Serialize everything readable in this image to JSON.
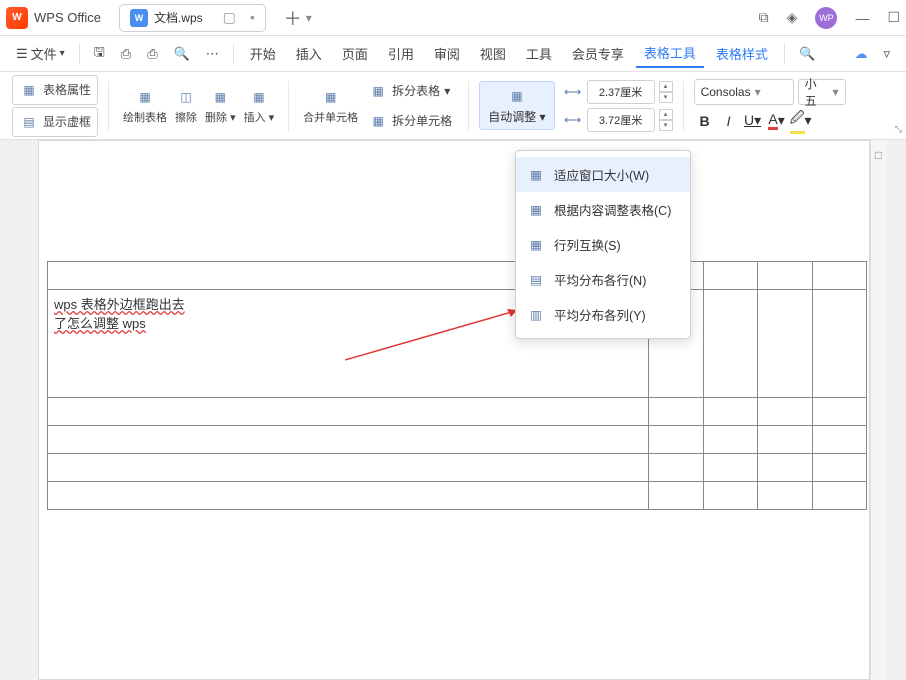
{
  "title_bar": {
    "app_name": "WPS Office",
    "tab_name": "文档.wps",
    "avatar": "WP"
  },
  "file_menu": {
    "label": "文件"
  },
  "menu": {
    "start": "开始",
    "insert": "插入",
    "page": "页面",
    "ref": "引用",
    "review": "审阅",
    "view": "视图",
    "tools": "工具",
    "member": "会员专享",
    "table_tools": "表格工具",
    "table_style": "表格样式"
  },
  "ribbon": {
    "table_props": "表格属性",
    "show_grid": "显示虚框",
    "draw_table": "绘制表格",
    "eraser": "擦除",
    "delete": "删除",
    "insert": "插入",
    "merge_cells": "合并单元格",
    "split_table": "拆分表格",
    "split_cells": "拆分单元格",
    "auto_adjust": "自动调整",
    "height": "2.37厘米",
    "width": "3.72厘米",
    "font_name": "Consolas",
    "font_size": "小五"
  },
  "dropdown": {
    "fit_window": "适应窗口大小(W)",
    "fit_content": "根据内容调整表格(C)",
    "swap": "行列互换(S)",
    "dist_rows": "平均分布各行(N)",
    "dist_cols": "平均分布各列(Y)"
  },
  "doc": {
    "cell_line1": "wps 表格外边框跑出去",
    "cell_line2": "了怎么调整 wps"
  }
}
